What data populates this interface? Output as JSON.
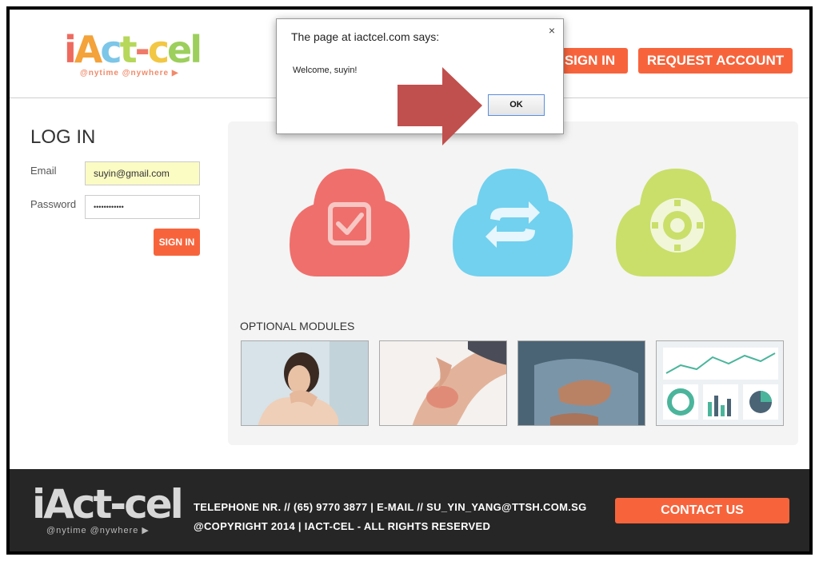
{
  "header": {
    "logo_text": "iAct-cel",
    "logo_tagline": "@nytime @nywhere",
    "sign_in_label": "SIGN IN",
    "request_account_label": "REQUEST ACCOUNT"
  },
  "login": {
    "title": "LOG IN",
    "email_label": "Email",
    "email_value": "suyin@gmail.com",
    "password_label": "Password",
    "password_value": "••••••••••••",
    "sign_in_label": "SIGN IN"
  },
  "main": {
    "clouds": [
      {
        "icon": "checkbox-icon",
        "color": "#ef6f6c"
      },
      {
        "icon": "sync-icon",
        "color": "#71d1ef"
      },
      {
        "icon": "gear-icon",
        "color": "#c9df6a"
      }
    ],
    "modules_title": "OPTIONAL MODULES",
    "modules": [
      {
        "icon": "neck-pain-photo"
      },
      {
        "icon": "knee-pain-photo"
      },
      {
        "icon": "chest-pain-photo"
      },
      {
        "icon": "dashboard-photo"
      }
    ]
  },
  "footer": {
    "logo_text": "iAct-cel",
    "logo_tagline": "@nytime @nywhere",
    "contact_line": "TELEPHONE NR. // (65) 9770 3877 | E-MAIL // SU_YIN_YANG@TTSH.COM.SG",
    "copyright_line": "@COPYRIGHT 2014 | IACT-CEL - ALL RIGHTS RESERVED",
    "contact_button": "CONTACT US"
  },
  "dialog": {
    "title": "The page at iactcel.com says:",
    "message": "Welcome, suyin!",
    "ok_label": "OK",
    "close_label": "×"
  },
  "colors": {
    "accent": "#f7643c",
    "footer_bg": "#262626",
    "arrow": "#c0504d"
  }
}
